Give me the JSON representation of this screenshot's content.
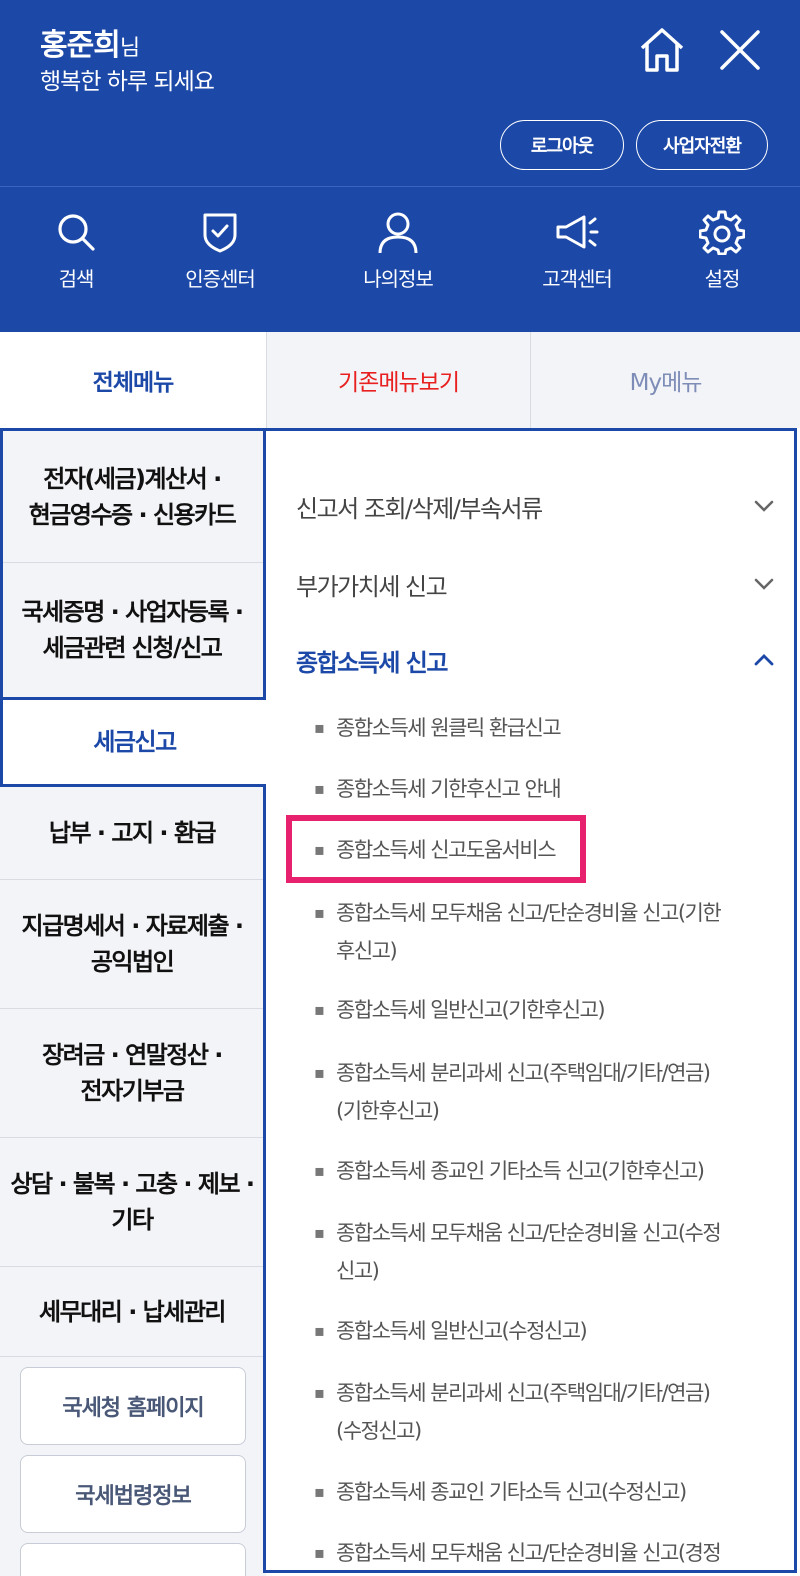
{
  "header": {
    "user_name": "홍준희",
    "user_suffix": "님",
    "greeting": "행복한 하루 되세요",
    "logout_label": "로그아웃",
    "business_switch_label": "사업자전환",
    "home_icon": "home-icon",
    "close_icon": "close-icon"
  },
  "quick_nav": [
    {
      "label": "검색",
      "icon": "search-icon"
    },
    {
      "label": "인증센터",
      "icon": "shield-check-icon"
    },
    {
      "label": "나의정보",
      "icon": "person-icon"
    },
    {
      "label": "고객센터",
      "icon": "megaphone-icon"
    },
    {
      "label": "설정",
      "icon": "gear-icon"
    }
  ],
  "tabs": [
    {
      "label": "전체메뉴",
      "active": true
    },
    {
      "label": "기존메뉴보기",
      "active": false
    },
    {
      "label": "My메뉴",
      "active": false
    }
  ],
  "categories": [
    {
      "line1": "전자(세금)계산서 ·",
      "line2": "현금영수증 · 신용카드"
    },
    {
      "line1": "국세증명 · 사업자등록 ·",
      "line2": "세금관련 신청/신고"
    },
    {
      "line1": "세금신고",
      "line2": "",
      "active": true
    },
    {
      "line1": "납부 · 고지 · 환급",
      "line2": ""
    },
    {
      "line1": "지급명세서 · 자료제출 ·",
      "line2": "공익법인"
    },
    {
      "line1": "장려금 · 연말정산 ·",
      "line2": "전자기부금"
    },
    {
      "line1": "상담 · 불복 · 고충 · 제보 ·",
      "line2": "기타"
    },
    {
      "line1": "세무대리 · 납세관리",
      "line2": ""
    }
  ],
  "side_buttons": [
    "국세청 홈페이지",
    "국세법령정보"
  ],
  "accordion": [
    {
      "label": "신고서 조회/삭제/부속서류",
      "open": false
    },
    {
      "label": "부가가치세 신고",
      "open": false
    },
    {
      "label": "종합소득세 신고",
      "open": true
    }
  ],
  "sub_items": [
    {
      "line1": "종합소득세 원클릭 환급신고",
      "line2": ""
    },
    {
      "line1": "종합소득세 기한후신고 안내",
      "line2": ""
    },
    {
      "line1": "종합소득세 신고도움서비스",
      "line2": "",
      "highlighted": true
    },
    {
      "line1": "종합소득세 모두채움 신고/단순경비율 신고(기한",
      "line2": "후신고)"
    },
    {
      "line1": "종합소득세 일반신고(기한후신고)",
      "line2": ""
    },
    {
      "line1": "종합소득세 분리과세 신고(주택임대/기타/연금)",
      "line2": "(기한후신고)"
    },
    {
      "line1": "종합소득세 종교인 기타소득 신고(기한후신고)",
      "line2": ""
    },
    {
      "line1": "종합소득세 모두채움 신고/단순경비율 신고(수정",
      "line2": "신고)"
    },
    {
      "line1": "종합소득세 일반신고(수정신고)",
      "line2": ""
    },
    {
      "line1": "종합소득세 분리과세 신고(주택임대/기타/연금)",
      "line2": "(수정신고)"
    },
    {
      "line1": "종합소득세 종교인 기타소득 신고(수정신고)",
      "line2": ""
    },
    {
      "line1": "종합소득세 모두채움 신고/단순경비율 신고(경정",
      "line2": ""
    }
  ],
  "colors": {
    "primary": "#1c48a8",
    "accent_red": "#e8201f",
    "highlight": "#e8216e"
  }
}
